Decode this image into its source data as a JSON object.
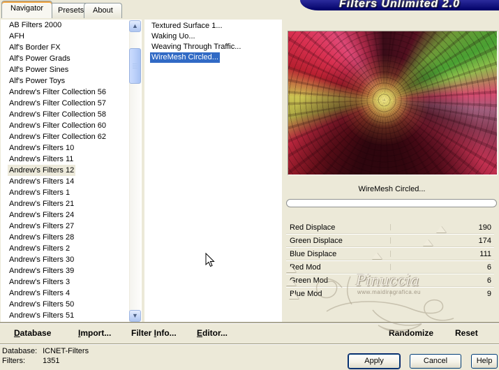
{
  "title": "Filters Unlimited 2.0",
  "tabs": {
    "navigator": "Navigator",
    "presets": "Presets",
    "about": "About"
  },
  "left_list": {
    "selected_index": 13,
    "items": [
      "AB Filters 2000",
      "AFH",
      "Alf's Border FX",
      "Alf's Power Grads",
      "Alf's Power Sines",
      "Alf's Power Toys",
      "Andrew's Filter Collection 56",
      "Andrew's Filter Collection 57",
      "Andrew's Filter Collection 58",
      "Andrew's Filter Collection 60",
      "Andrew's Filter Collection 62",
      "Andrew's Filters 10",
      "Andrew's Filters 11",
      "Andrew's Filters 12",
      "Andrew's Filters 14",
      "Andrew's Filters 1",
      "Andrew's Filters 21",
      "Andrew's Filters 24",
      "Andrew's Filters 27",
      "Andrew's Filters 28",
      "Andrew's Filters 2",
      "Andrew's Filters 30",
      "Andrew's Filters 39",
      "Andrew's Filters 3",
      "Andrew's Filters 4",
      "Andrew's Filters 50",
      "Andrew's Filters 51"
    ]
  },
  "middle_list": {
    "selected_index": 3,
    "items": [
      "Textured Surface 1...",
      "Waking Uo...",
      "Weaving Through Traffic...",
      "WireMesh Circled..."
    ]
  },
  "preview": {
    "filter_name": "WireMesh Circled...",
    "progress_percent": 0
  },
  "sliders": {
    "range_min": 0,
    "range_max": 255,
    "items": [
      {
        "label": "Red Displace",
        "value": 190
      },
      {
        "label": "Green Displace",
        "value": 174
      },
      {
        "label": "Blue Displace",
        "value": 111
      },
      {
        "label": "Red Mod",
        "value": 6
      },
      {
        "label": "Green Mod",
        "value": 6
      },
      {
        "label": "Blue Mod",
        "value": 9
      }
    ]
  },
  "command_bar": {
    "items": [
      {
        "label": "Database",
        "underline": 0
      },
      {
        "label": "Import...",
        "underline": 0
      },
      {
        "label": "Filter Info...",
        "underline": 7
      },
      {
        "label": "Editor...",
        "underline": 0
      },
      {
        "label": "Randomize",
        "underline": -1
      },
      {
        "label": "Reset",
        "underline": -1
      }
    ]
  },
  "status": {
    "database_label": "Database:",
    "database_value": "ICNET-Filters",
    "filters_label": "Filters:",
    "filters_value": "1351"
  },
  "dialog_buttons": {
    "apply": "Apply",
    "cancel": "Cancel",
    "help": "Help"
  },
  "watermark": {
    "name": "Pinuccia",
    "url": "www.maidiragrafica.eu"
  },
  "colors": {
    "selection": "#316AC5",
    "banner": "#000066",
    "chrome": "#ECE9D8"
  }
}
